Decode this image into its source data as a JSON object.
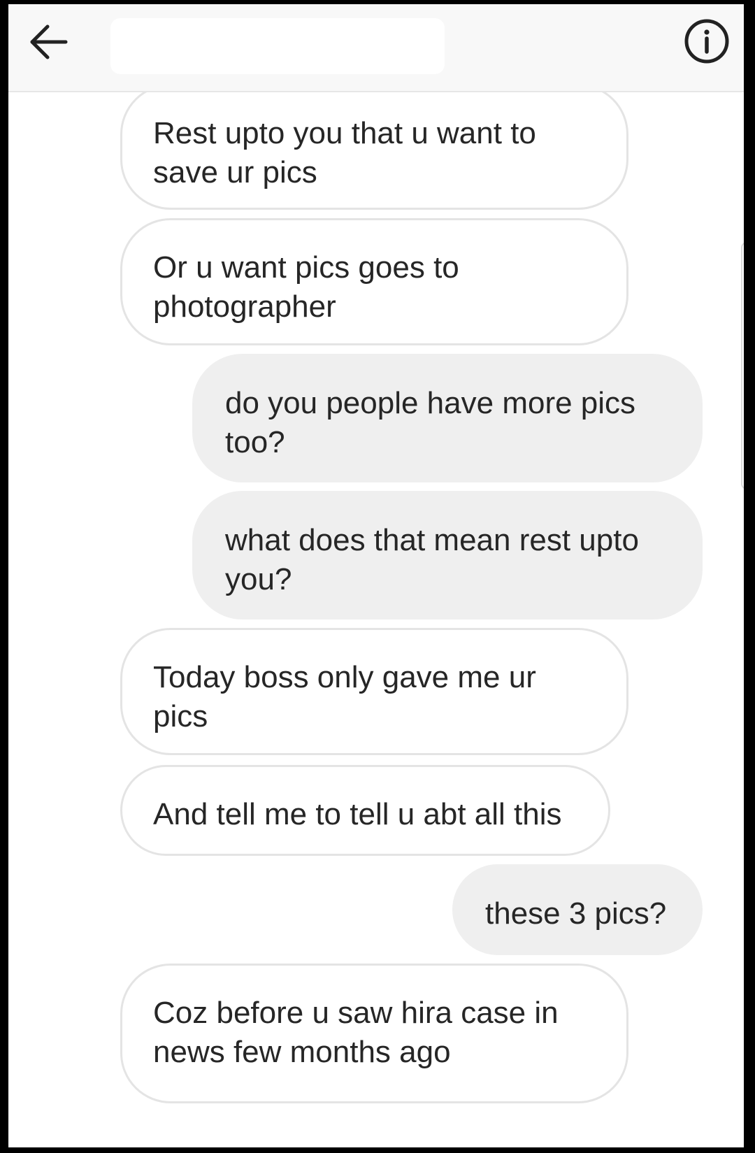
{
  "header": {
    "back_icon": "arrow-left-icon",
    "info_icon": "info-circle-icon",
    "title": ""
  },
  "messages": [
    {
      "direction": "received",
      "text": "Rest upto you that u want to save ur pics"
    },
    {
      "direction": "received",
      "text": "Or u want pics goes to photographer"
    },
    {
      "direction": "sent",
      "text": "do you people have more pics too?"
    },
    {
      "direction": "sent",
      "text": "what does that mean rest upto you?"
    },
    {
      "direction": "received",
      "text": "Today boss only gave me ur pics"
    },
    {
      "direction": "received",
      "text": "And tell me to tell u abt all this"
    },
    {
      "direction": "sent",
      "text": "these 3 pics?"
    },
    {
      "direction": "received",
      "text": "Coz before u saw hira case in news few months ago"
    }
  ],
  "colors": {
    "sent_bubble": "#efefef",
    "received_bubble_border": "#e4e4e4",
    "text": "#262626",
    "header_bg": "#f8f8f8"
  }
}
